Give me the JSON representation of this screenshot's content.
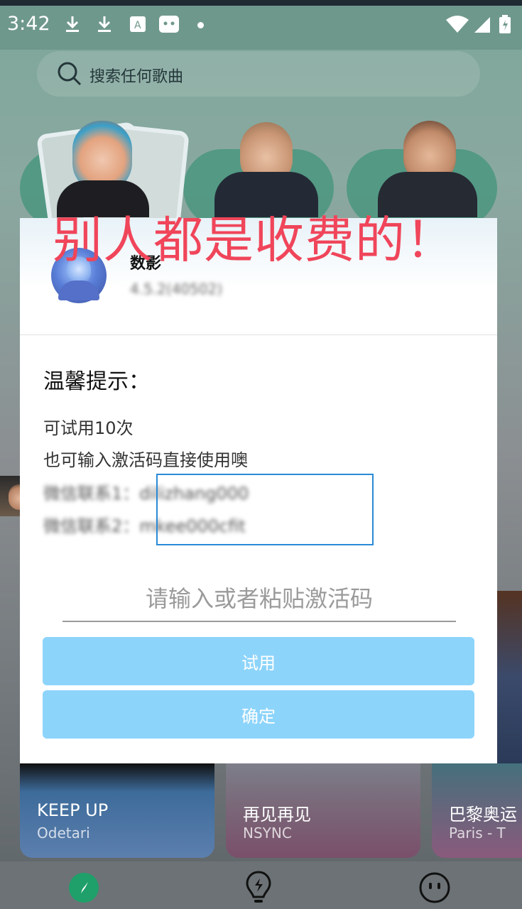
{
  "status_bar": {
    "time": "3:42"
  },
  "search": {
    "placeholder": "搜索任何歌曲"
  },
  "overlay": {
    "annotation": "别人都是收费的！"
  },
  "dialog": {
    "app_name": "数影",
    "app_version": "4.5.2(40502)",
    "tip_title": "温馨提示：",
    "lines": [
      "可试用10次",
      "也可输入激活码直接使用噢",
      "微信联系1：dilizhang000",
      "微信联系2：mkee000cfit"
    ],
    "input_placeholder": "请输入或者粘贴激活码",
    "trial_button": "试用",
    "confirm_button": "确定"
  },
  "cards": [
    {
      "title": "KEEP UP",
      "artist": "Odetari"
    },
    {
      "title": "再见再见",
      "artist": "NSYNC"
    },
    {
      "title": "巴黎奥运",
      "artist": "Paris - T"
    }
  ],
  "colors": {
    "accent": "#8dd4fb",
    "overlay_text": "#f0455a",
    "nav_active": "#1fa06a"
  }
}
